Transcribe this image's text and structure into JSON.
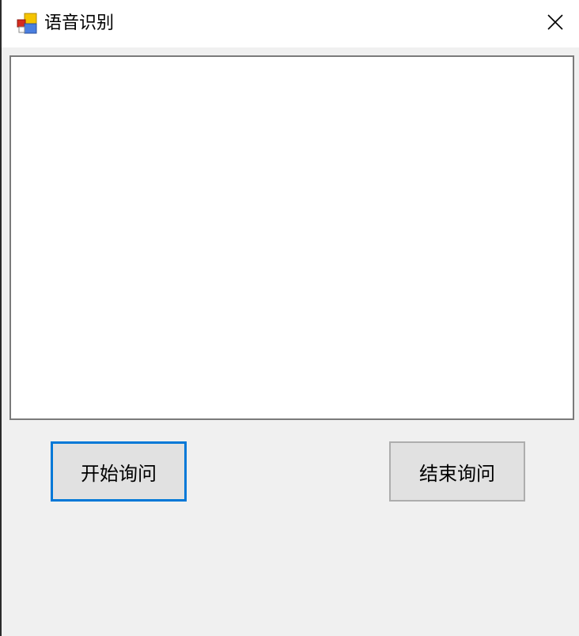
{
  "window": {
    "title": "语音识别",
    "close_glyph": "close-icon",
    "app_icon": "windows-forms-app-icon"
  },
  "main": {
    "text_area": {
      "value": ""
    },
    "buttons": {
      "start_label": "开始询问",
      "end_label": "结束询问"
    }
  },
  "colors": {
    "focus_border": "#0078d7",
    "button_bg": "#e1e1e1",
    "window_bg": "#f0f0f0"
  }
}
